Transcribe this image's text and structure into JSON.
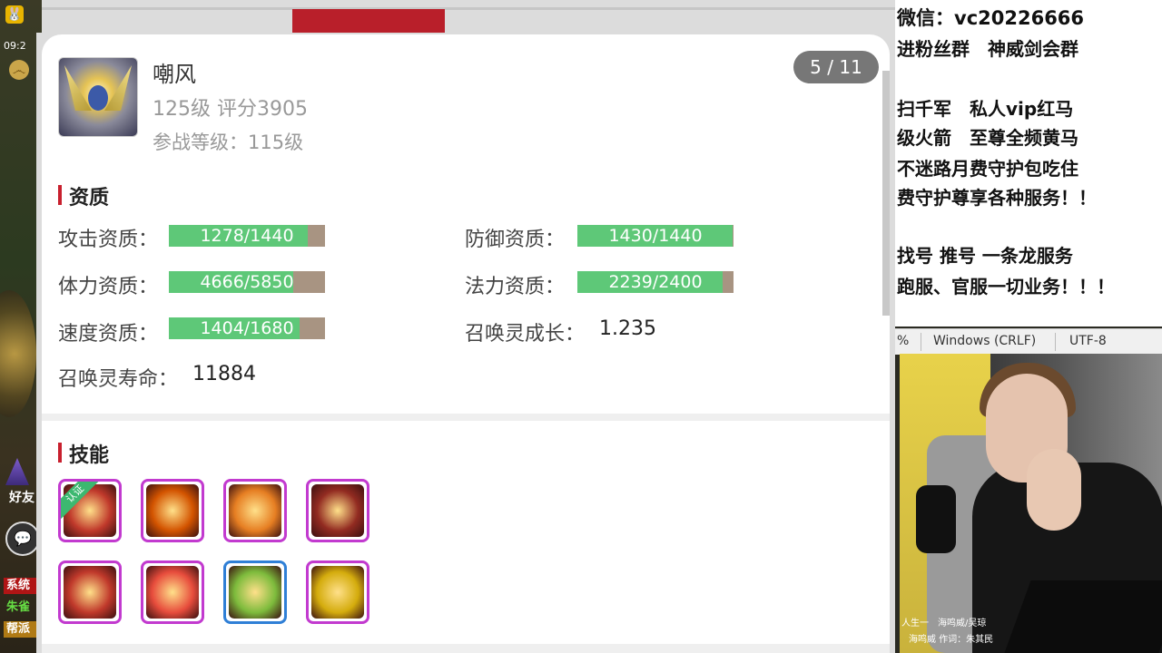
{
  "game": {
    "logo_char": "🐰",
    "clock": "09:2",
    "friend_label": "好友",
    "tags": [
      "系统",
      "朱雀",
      "帮派"
    ]
  },
  "panel": {
    "pet_name": "嘲风",
    "level_score": "125级 评分3905",
    "battle_level": "参战等级：115级",
    "pager": "5 / 11",
    "aptitude_title": "资质",
    "skills_title": "技能",
    "attack": {
      "label": "攻击资质：",
      "value": "1278/1440",
      "ratio": 0.8875
    },
    "defense": {
      "label": "防御资质：",
      "value": "1430/1440",
      "ratio": 0.9931
    },
    "stamina": {
      "label": "体力资质：",
      "value": "4666/5850",
      "ratio": 0.7976
    },
    "magic": {
      "label": "法力资质：",
      "value": "2239/2400",
      "ratio": 0.9329
    },
    "speed": {
      "label": "速度资质：",
      "value": "1404/1680",
      "ratio": 0.8357
    },
    "growth": {
      "label": "召唤灵成长：",
      "value": "1.235"
    },
    "lifespan": {
      "label": "召唤灵寿命：",
      "value": "11884"
    },
    "skills": [
      {
        "name": "skill-1",
        "certified": true,
        "cert_label": "认证",
        "color": "#c0392b"
      },
      {
        "name": "skill-2",
        "certified": false,
        "color": "#d35400"
      },
      {
        "name": "skill-3",
        "certified": false,
        "color": "#e67e22"
      },
      {
        "name": "skill-4",
        "certified": false,
        "color": "#922b21"
      },
      {
        "name": "skill-5",
        "certified": false,
        "color": "#c0392b"
      },
      {
        "name": "skill-6",
        "certified": false,
        "color": "#e74c3c"
      },
      {
        "name": "skill-7",
        "certified": false,
        "color": "#7dbb3c",
        "border": "blue"
      },
      {
        "name": "skill-8",
        "certified": false,
        "color": "#d4ac0d"
      }
    ]
  },
  "promo": {
    "lines": [
      "微信：vc20226666",
      "进粉丝群　神威剑会群",
      "扫千军　私人vip红马",
      "级火箭　至尊全频黄马",
      "不迷路月费守护包吃住",
      "费守护尊享各种服务！！",
      "找号 推号 一条龙服务",
      "跑服、官服一切业务！！！"
    ],
    "status": {
      "percent": "%",
      "line_ending": "Windows (CRLF)",
      "encoding": "UTF-8"
    }
  },
  "cam": {
    "lyrics1": "人生一　海鸣威/吴琼",
    "lyrics2": "海鸣威 作词：朱其民"
  }
}
